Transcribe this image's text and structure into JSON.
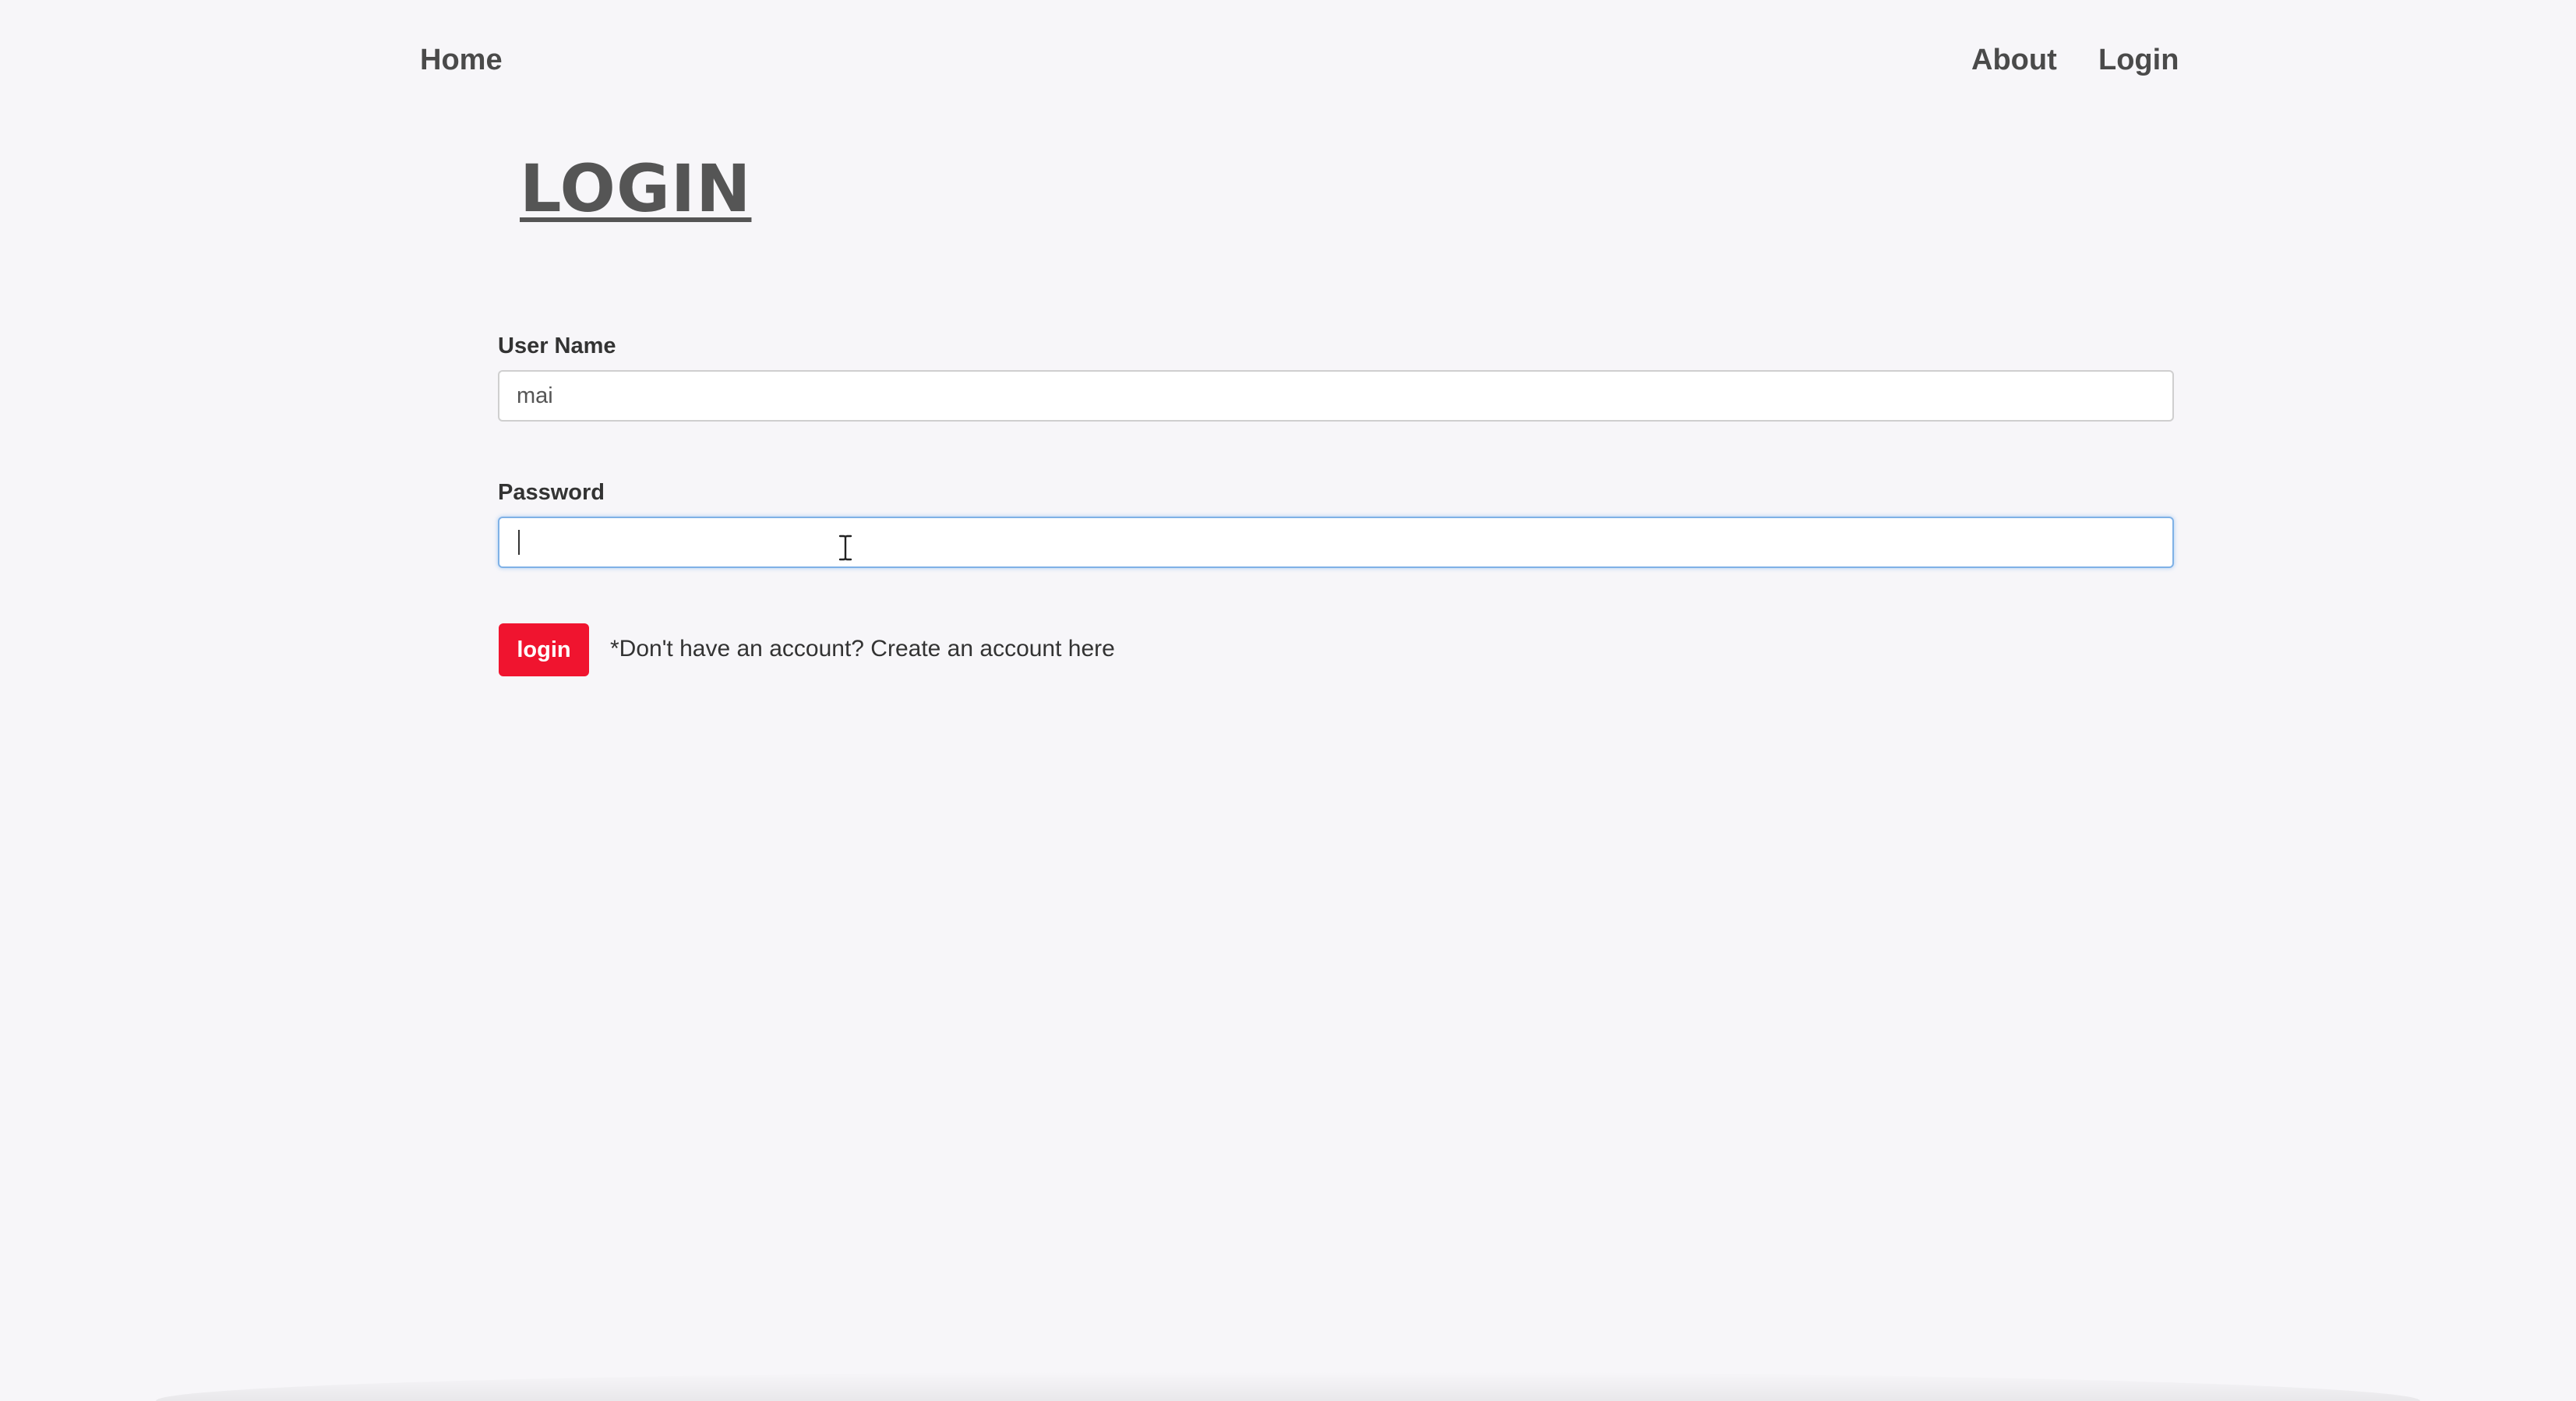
{
  "nav": {
    "home": "Home",
    "about": "About",
    "login": "Login"
  },
  "page_title": "LOGIN",
  "form": {
    "username": {
      "label": "User Name",
      "value": "mai"
    },
    "password": {
      "label": "Password",
      "value": ""
    },
    "submit_label": "login",
    "signup_prefix": "*Don't have an account? ",
    "signup_link": "Create an account here"
  },
  "colors": {
    "accent": "#f0142f",
    "background": "#f7f6f9",
    "focus_border": "#7fb1e6"
  },
  "icons": {
    "cursor": "text-cursor-icon"
  }
}
